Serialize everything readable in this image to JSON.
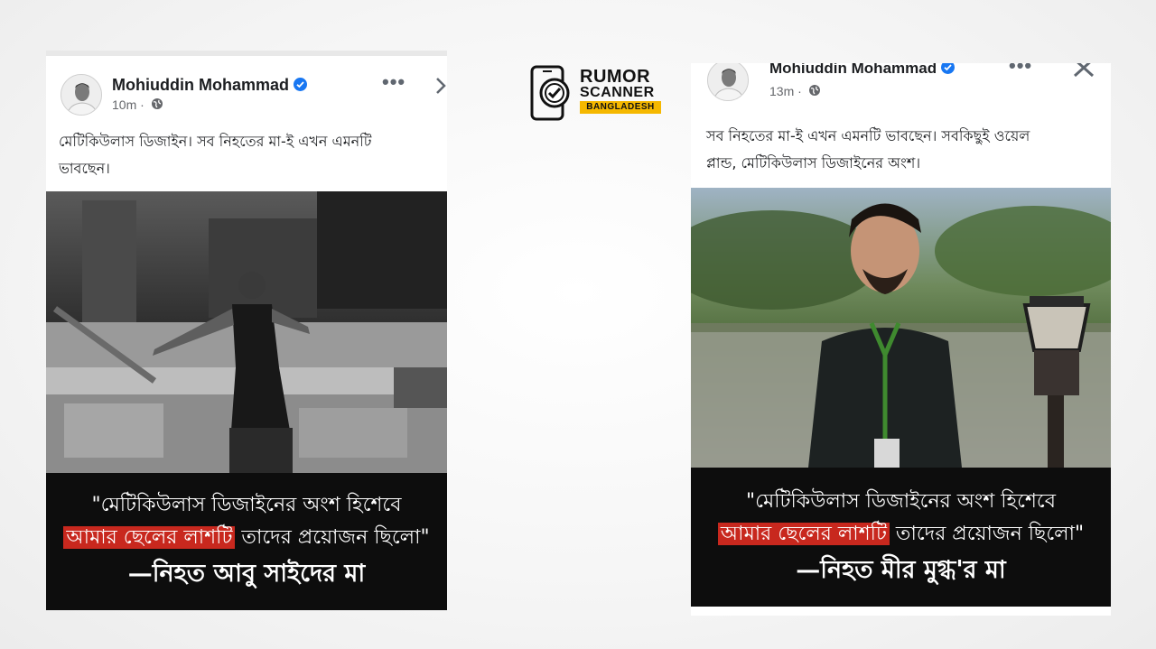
{
  "logo": {
    "line1": "RUMOR",
    "line2": "SCANNER",
    "line3": "BANGLADESH",
    "brand_color": "#f5b800"
  },
  "posts": [
    {
      "author": "Mohiuddin Mohammad",
      "time": "10m ·",
      "caption": "মেটিকিউলাস ডিজাইন। সব নিহতের মা-ই এখন এমনটি\nভাবছেন।",
      "quote_part1": "\"মেটিকিউলাস ডিজাইনের অংশ হিশেবে",
      "quote_highlight": "আমার ছেলের লাশটি",
      "quote_part2": " তাদের প্রয়োজন ছিলো\"",
      "attribution": "—নিহত আবু সাইদের মা"
    },
    {
      "author": "Mohiuddin Mohammad",
      "time": "13m ·",
      "caption": "সব নিহতের মা-ই এখন এমনটি ভাবছেন। সবকিছুই ওয়েল\nপ্লান্ড, মেটিকিউলাস ডিজাইনের অংশ।",
      "quote_part1": "\"মেটিকিউলাস ডিজাইনের অংশ হিশেবে",
      "quote_highlight": "আমার ছেলের লাশটি",
      "quote_part2": " তাদের প্রয়োজন ছিলো\"",
      "attribution": "—নিহত মীর মুগ্ধ'র মা"
    }
  ],
  "colors": {
    "verified_badge": "#1877f2",
    "quote_highlight": "#c8281e"
  },
  "icons": {
    "verified": "verified-badge-icon",
    "globe": "globe-icon",
    "more": "more-options-icon",
    "close": "close-icon",
    "chevron": "chevron-right-icon"
  }
}
